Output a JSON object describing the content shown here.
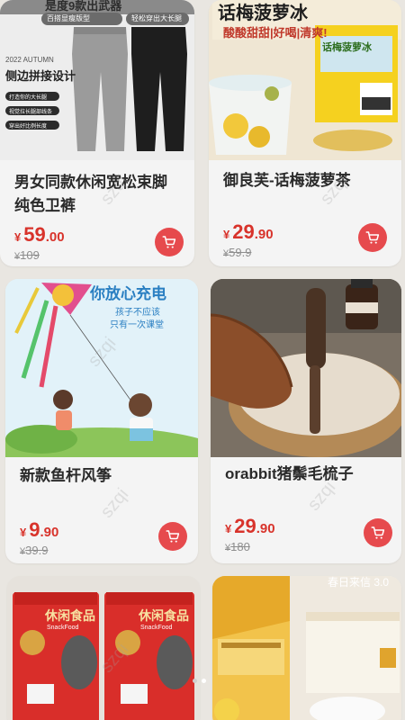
{
  "products": [
    {
      "title": "男女同款休闲宽松束脚纯色卫裤",
      "price": {
        "currency": "¥",
        "int": "59",
        "dec": ".00"
      },
      "original": "109",
      "image_text": {
        "banner": "是度9款出武器",
        "tags": [
          "百搭显瘦版型",
          "轻松穿出大长腿"
        ],
        "season": "2022 AUTUMN",
        "headline": "侧边拼接设计",
        "bullets": [
          "打造你的大长腿",
          "视觉拉长腿部线条",
          "穿出好比例长度"
        ]
      }
    },
    {
      "title": "御良芙-话梅菠萝茶",
      "price": {
        "currency": "¥",
        "int": "29",
        "dec": ".90"
      },
      "original": "59.9",
      "image_text": {
        "headline": "话梅菠萝冰",
        "sub": "酸酸甜甜|好喝|清爽!",
        "box": "话梅菠萝冰"
      }
    },
    {
      "title": "新款鱼杆风筝",
      "price": {
        "currency": "¥",
        "int": "9",
        "dec": ".90"
      },
      "original": "39.9",
      "image_text": {
        "headline": "你放心充电",
        "line1": "孩子不应该",
        "line2": "只有一次课堂"
      }
    },
    {
      "title": "orabbit猪鬃毛梳子",
      "price": {
        "currency": "¥",
        "int": "29",
        "dec": ".90"
      },
      "original": "180",
      "image_text": {}
    },
    {
      "title": "",
      "price": null,
      "original": "",
      "image_text": {
        "bag_label": "休闲食品",
        "bag_sub": "SnackFood"
      }
    },
    {
      "title": "",
      "price": null,
      "original": "",
      "image_text": {
        "corner": "春日来信 3.0"
      }
    }
  ],
  "watermark": "szqi",
  "pager": {
    "count": 2,
    "active": 1
  },
  "colors": {
    "background": "#e9e6e1",
    "card": "#f4f4f4",
    "price": "#d8332b",
    "cart_button": "#e64a4d"
  },
  "icons": [
    "cart-icon"
  ]
}
